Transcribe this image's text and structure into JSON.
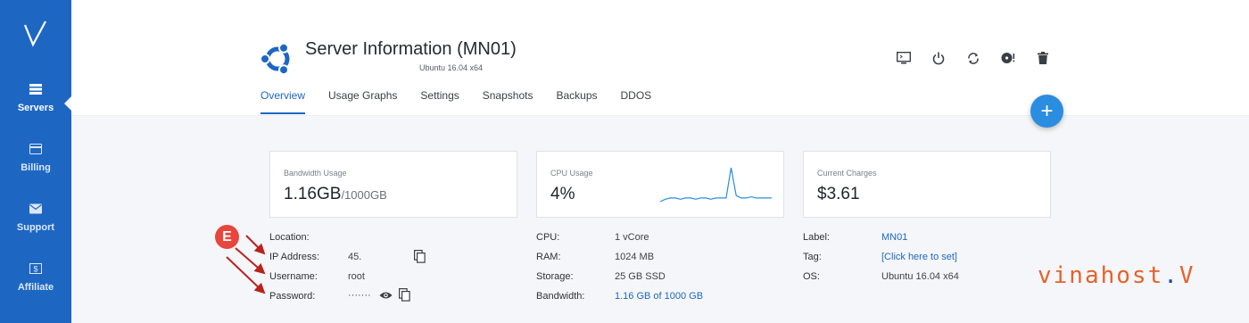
{
  "sidebar": {
    "logo": "V",
    "items": [
      {
        "label": "Servers",
        "icon": "servers-icon",
        "active": true
      },
      {
        "label": "Billing",
        "icon": "billing-icon",
        "active": false
      },
      {
        "label": "Support",
        "icon": "support-icon",
        "active": false
      },
      {
        "label": "Affiliate",
        "icon": "affiliate-icon",
        "active": false
      }
    ]
  },
  "header": {
    "title": "Server Information (MN01)",
    "subtitle": "Ubuntu 16.04 x64",
    "os_icon": "ubuntu-icon"
  },
  "tabs": [
    "Overview",
    "Usage Graphs",
    "Settings",
    "Snapshots",
    "Backups",
    "DDOS"
  ],
  "active_tab": "Overview",
  "actions": [
    "console-icon",
    "power-icon",
    "restart-icon",
    "reinstall-icon",
    "delete-icon"
  ],
  "fab_label": "+",
  "cards": {
    "bandwidth": {
      "label": "Bandwidth Usage",
      "value": "1.16GB",
      "suffix": "/1000GB"
    },
    "cpu": {
      "label": "CPU Usage",
      "value": "4%",
      "sparkline": [
        0,
        2,
        3,
        3,
        2,
        3,
        3,
        2,
        3,
        3,
        2,
        3,
        3,
        3,
        28,
        5,
        3,
        3,
        4,
        3,
        3,
        3,
        3
      ]
    },
    "charges": {
      "label": "Current Charges",
      "value": "$3.61"
    }
  },
  "info_left": [
    {
      "key": "Location:",
      "value": ""
    },
    {
      "key": "IP Address:",
      "value": "45."
    },
    {
      "key": "Username:",
      "value": "root"
    },
    {
      "key": "Password:",
      "value": "·······"
    }
  ],
  "info_mid": [
    {
      "key": "CPU:",
      "value": "1 vCore"
    },
    {
      "key": "RAM:",
      "value": "1024 MB"
    },
    {
      "key": "Storage:",
      "value": "25 GB SSD"
    },
    {
      "key": "Bandwidth:",
      "value": "1.16 GB of 1000 GB"
    }
  ],
  "info_right": [
    {
      "key": "Label:",
      "value": "MN01"
    },
    {
      "key": "Tag:",
      "value": "[Click here to set]"
    },
    {
      "key": "OS:",
      "value": "Ubuntu 16.04 x64"
    }
  ],
  "annotation_badge": "E",
  "watermark": {
    "text": "vinahost",
    "dot": ".",
    "mark": "V"
  },
  "colors": {
    "sidebar": "#1d67c3",
    "accent": "#1d67c3",
    "fab": "#2a8de0",
    "badge": "#e8453c",
    "watermark": "#e4632a"
  }
}
